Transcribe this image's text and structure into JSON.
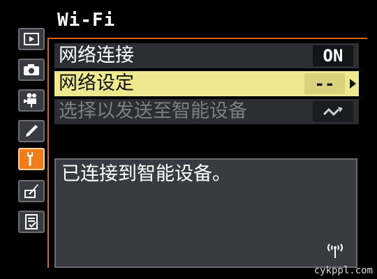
{
  "header": {
    "title": "Wi-Fi"
  },
  "tabs": [
    {
      "name": "playback-menu",
      "icon": "play-icon",
      "active": false
    },
    {
      "name": "shooting-menu",
      "icon": "camera-icon",
      "active": false
    },
    {
      "name": "movie-menu",
      "icon": "movie-camera-icon",
      "active": false
    },
    {
      "name": "custom-settings-menu",
      "icon": "pencil-icon",
      "active": false
    },
    {
      "name": "setup-menu",
      "icon": "wrench-icon",
      "active": true
    },
    {
      "name": "retouch-menu",
      "icon": "brush-icon",
      "active": false
    },
    {
      "name": "my-menu",
      "icon": "checklist-icon",
      "active": false
    }
  ],
  "menu": {
    "items": [
      {
        "label": "网络连接",
        "value": "ON",
        "selected": false,
        "enabled": true
      },
      {
        "label": "网络设定",
        "value": "--",
        "selected": true,
        "enabled": true
      },
      {
        "label": "选择以发送至智能设备",
        "value": "",
        "value_icon": "send-to-smart-device-icon",
        "selected": false,
        "enabled": false
      }
    ]
  },
  "info": {
    "text": "已连接到智能设备。",
    "icon": "wireless-signal-icon"
  },
  "watermark": "cykppl.com",
  "colors": {
    "accent": "#f07d1a",
    "selected_row": "#eee98e",
    "frame": "#d4631a",
    "row_bg": "#2d2e34"
  }
}
